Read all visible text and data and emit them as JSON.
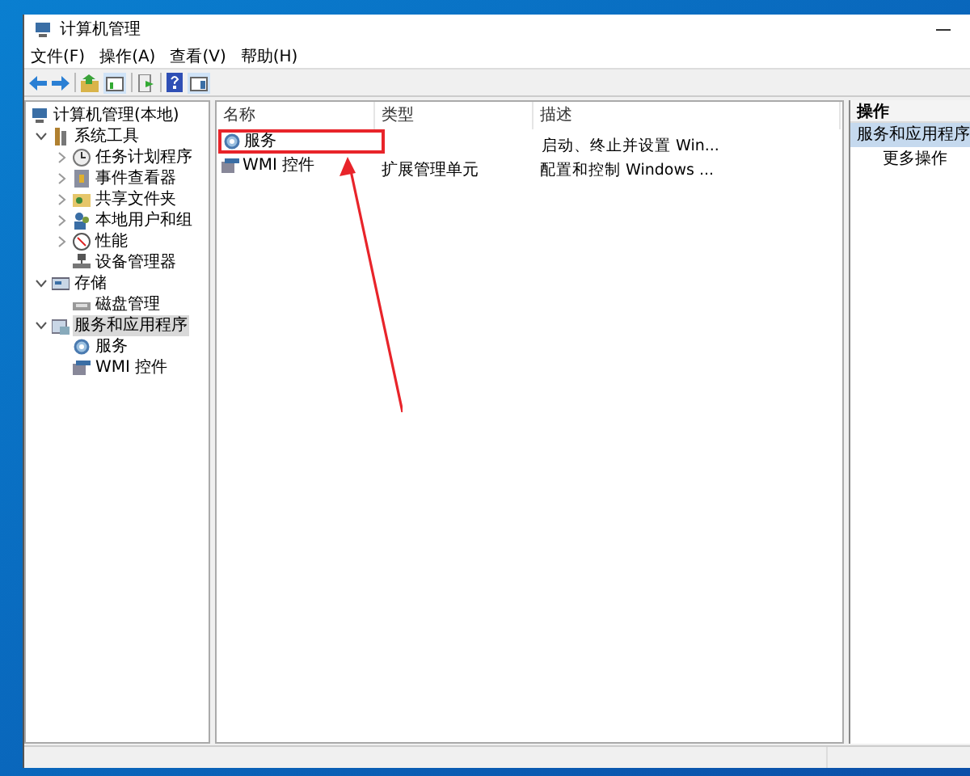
{
  "window": {
    "title": "计算机管理"
  },
  "menu": [
    "文件(F)",
    "操作(A)",
    "查看(V)",
    "帮助(H)"
  ],
  "tree": [
    {
      "label": "计算机管理(本地)",
      "selected": false,
      "children": [
        {
          "label": "系统工具",
          "expanded": true,
          "selected": false,
          "children": [
            {
              "label": "任务计划程序",
              "expanded": false,
              "selected": false
            },
            {
              "label": "事件查看器",
              "expanded": false,
              "selected": false
            },
            {
              "label": "共享文件夹",
              "expanded": false,
              "selected": false
            },
            {
              "label": "本地用户和组",
              "expanded": false,
              "selected": false
            },
            {
              "label": "性能",
              "expanded": false,
              "selected": false
            },
            {
              "label": "设备管理器",
              "selected": false
            }
          ]
        },
        {
          "label": "存储",
          "expanded": true,
          "selected": false,
          "children": [
            {
              "label": "磁盘管理",
              "selected": false
            }
          ]
        },
        {
          "label": "服务和应用程序",
          "expanded": true,
          "selected": true,
          "children": [
            {
              "label": "服务",
              "selected": false
            },
            {
              "label": "WMI 控件",
              "selected": false
            }
          ]
        }
      ]
    }
  ],
  "list": {
    "columns": [
      "名称",
      "类型",
      "描述"
    ],
    "rows": [
      {
        "name": "服务",
        "description": "启动、终止并设置 Win..."
      },
      {
        "name": "WMI 控件",
        "type": "扩展管理单元",
        "description": "配置和控制 Windows ..."
      }
    ]
  },
  "actions": {
    "title": "操作",
    "items": [
      {
        "label": "服务和应用程序",
        "selected": true
      },
      {
        "label": "更多操作",
        "selected": false
      }
    ]
  }
}
